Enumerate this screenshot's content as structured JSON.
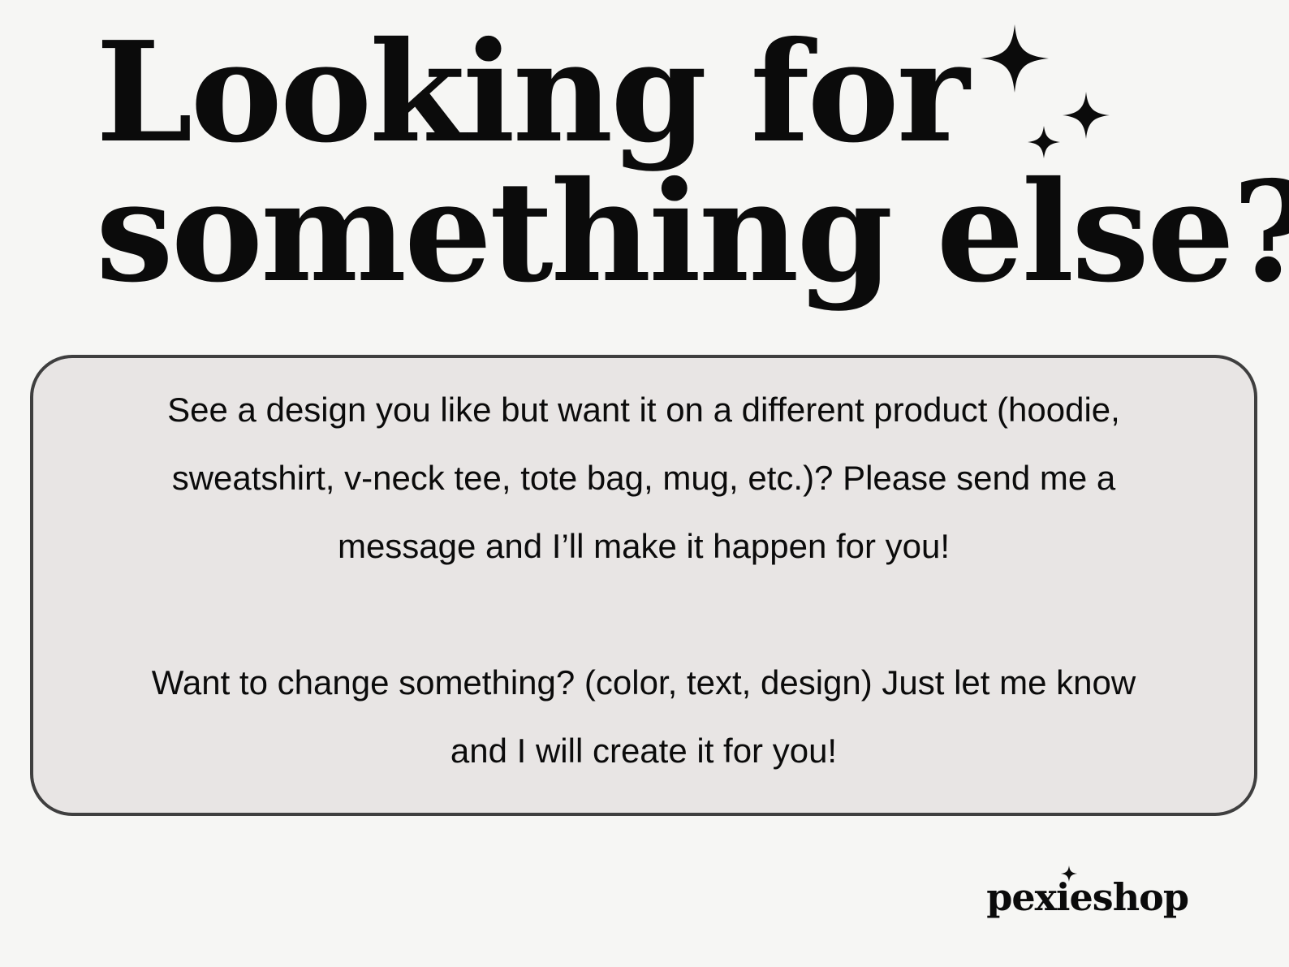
{
  "headline": {
    "line1": "Looking for",
    "line2": "something else?"
  },
  "card": {
    "paragraph1": "See a design you like but want it on a different product (hoodie, sweatshirt, v-neck tee, tote bag, mug, etc.)? Please send me a message and I’ll make it happen for you!",
    "paragraph2": "Want to change something? (color, text, design) Just let me know and I will create it for you!"
  },
  "brand": {
    "name": "pexieshop"
  },
  "decor": {
    "icons": [
      "sparkle-icon",
      "sparkle-icon",
      "sparkle-icon"
    ]
  },
  "colors": {
    "background": "#f6f6f4",
    "card": "#e8e5e4",
    "border": "#3f3f3f",
    "text": "#0b0b0b"
  }
}
